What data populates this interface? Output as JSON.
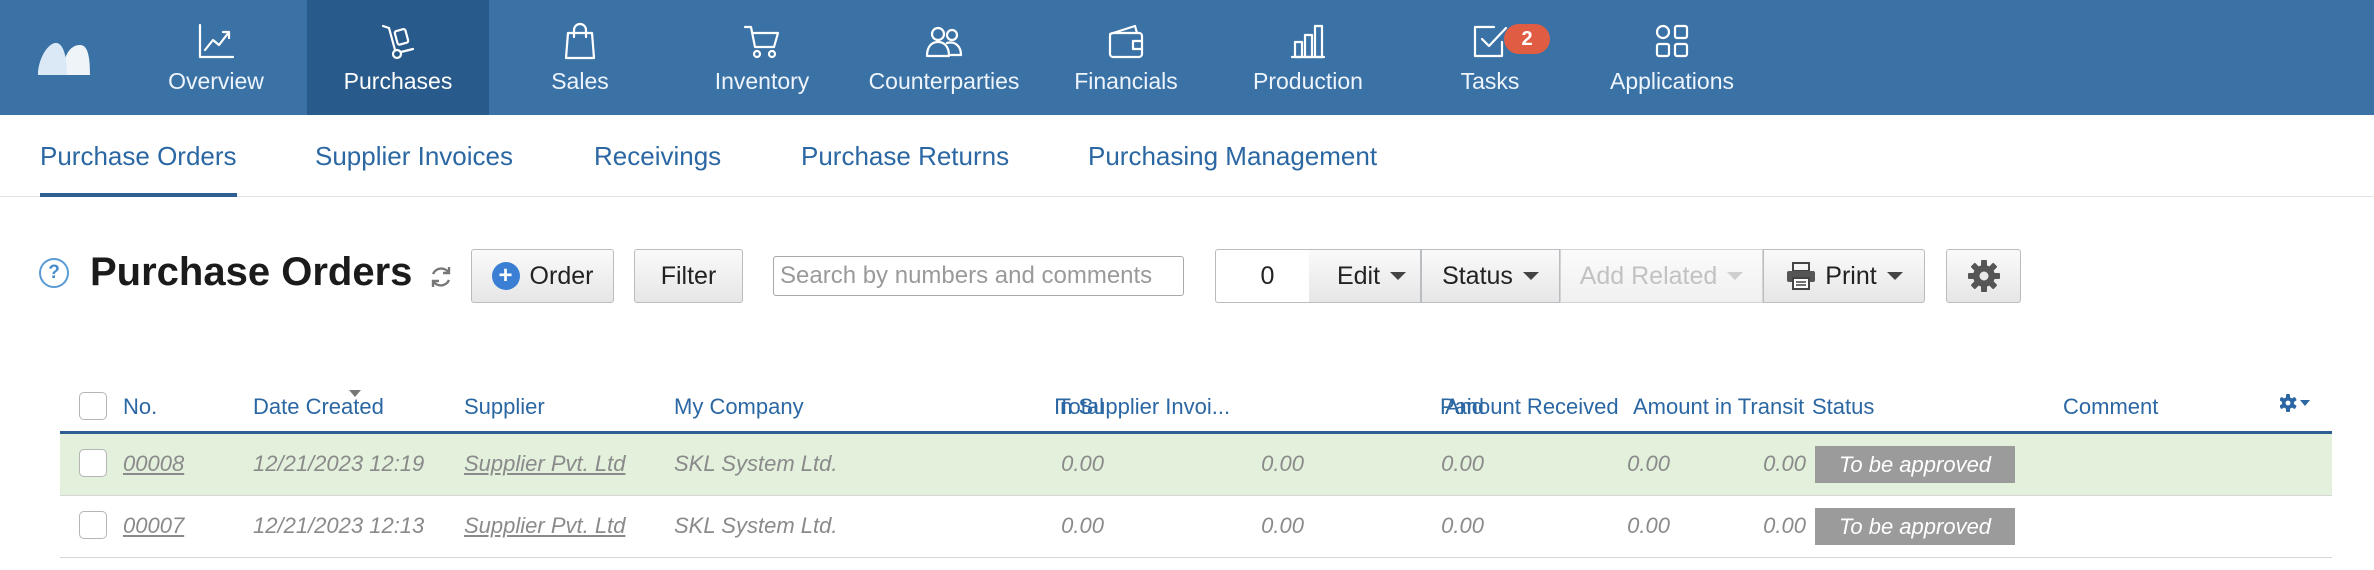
{
  "nav": {
    "items": [
      {
        "label": "Overview",
        "icon": "chart-line-icon",
        "active": false
      },
      {
        "label": "Purchases",
        "icon": "hand-truck-icon",
        "active": true
      },
      {
        "label": "Sales",
        "icon": "shopping-bag-icon",
        "active": false
      },
      {
        "label": "Inventory",
        "icon": "shopping-cart-icon",
        "active": false
      },
      {
        "label": "Counterparties",
        "icon": "users-icon",
        "active": false
      },
      {
        "label": "Financials",
        "icon": "wallet-icon",
        "active": false
      },
      {
        "label": "Production",
        "icon": "factory-icon",
        "active": false
      },
      {
        "label": "Tasks",
        "icon": "checkbox-icon",
        "active": false,
        "badge": "2"
      },
      {
        "label": "Applications",
        "icon": "apps-grid-icon",
        "active": false
      }
    ]
  },
  "subtabs": [
    "Purchase Orders",
    "Supplier Invoices",
    "Receivings",
    "Purchase Returns",
    "Purchasing Management"
  ],
  "toolbar": {
    "help": "?",
    "title": "Purchase Orders",
    "order_label": "Order",
    "filter_label": "Filter",
    "search_placeholder": "Search by numbers and comments",
    "selected_count": "0",
    "edit_label": "Edit",
    "status_label": "Status",
    "add_related_label": "Add Related",
    "print_label": "Print"
  },
  "table": {
    "columns": {
      "no": "No.",
      "date": "Date Created",
      "supplier": "Supplier",
      "company": "My Company",
      "total": "Total",
      "invoiced": "In Supplier Invoi...",
      "paid": "Paid",
      "received": "Amount Received",
      "transit": "Amount in Transit",
      "status": "Status",
      "comment": "Comment"
    },
    "rows": [
      {
        "no": "00008",
        "date": "12/21/2023 12:19",
        "supplier": "Supplier Pvt. Ltd",
        "company": "SKL System Ltd.",
        "total": "0.00",
        "invoiced": "0.00",
        "paid": "0.00",
        "received": "0.00",
        "transit": "0.00",
        "status": "To be approved",
        "comment": ""
      },
      {
        "no": "00007",
        "date": "12/21/2023 12:13",
        "supplier": "Supplier Pvt. Ltd",
        "company": "SKL System Ltd.",
        "total": "0.00",
        "invoiced": "0.00",
        "paid": "0.00",
        "received": "0.00",
        "transit": "0.00",
        "status": "To be approved",
        "comment": ""
      }
    ]
  },
  "colors": {
    "nav_bg": "#3b72a6",
    "nav_active": "#285a8b",
    "link": "#2b67a3",
    "badge": "#e05d43",
    "row_highlight": "#e2f0dc",
    "status_badge": "#9b9b9b"
  }
}
